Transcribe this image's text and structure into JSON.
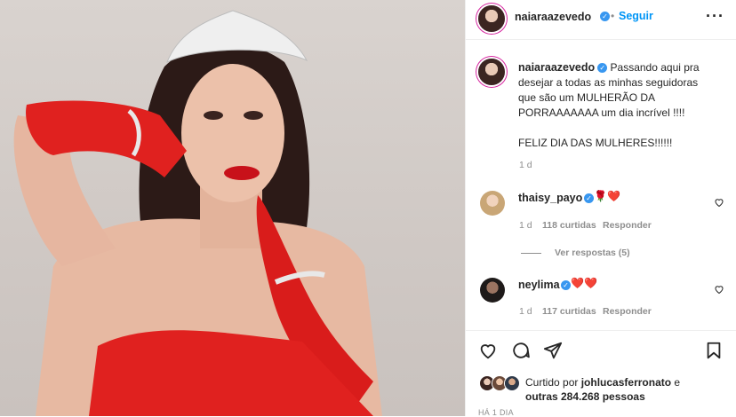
{
  "post": {
    "author": "naiaraazevedo",
    "follow_label": "Seguir",
    "more_icon": "more-dots-icon"
  },
  "caption": {
    "author": "naiaraazevedo",
    "text_line1": "Passando aqui pra",
    "text_line2": "desejar a todas as minhas seguidoras",
    "text_line3": "que são um MULHERÃO DA",
    "text_line4": "PORRAAAAAAA um dia incrível !!!!",
    "text_line5": "FELIZ DIA DAS MULHERES!!!!!!",
    "time": "1 d"
  },
  "comments": [
    {
      "username": "thaisy_payo",
      "emoji": "🌹❤️",
      "time": "1 d",
      "likes": "118 curtidas",
      "reply": "Responder",
      "view_replies": "Ver respostas (5)"
    },
    {
      "username": "neylima",
      "emoji": "❤️❤️",
      "time": "1 d",
      "likes": "117 curtidas",
      "reply": "Responder"
    }
  ],
  "likes": {
    "prefix": "Curtido por",
    "user": "johlucasferronato",
    "connector": "e",
    "others": "outras 284.268 pessoas"
  },
  "timestamp": "HÁ 1 DIA",
  "colors": {
    "accent": "#0095f6",
    "verified": "#3897f0",
    "heart": "#ed4956",
    "dress": "#e0211f"
  }
}
